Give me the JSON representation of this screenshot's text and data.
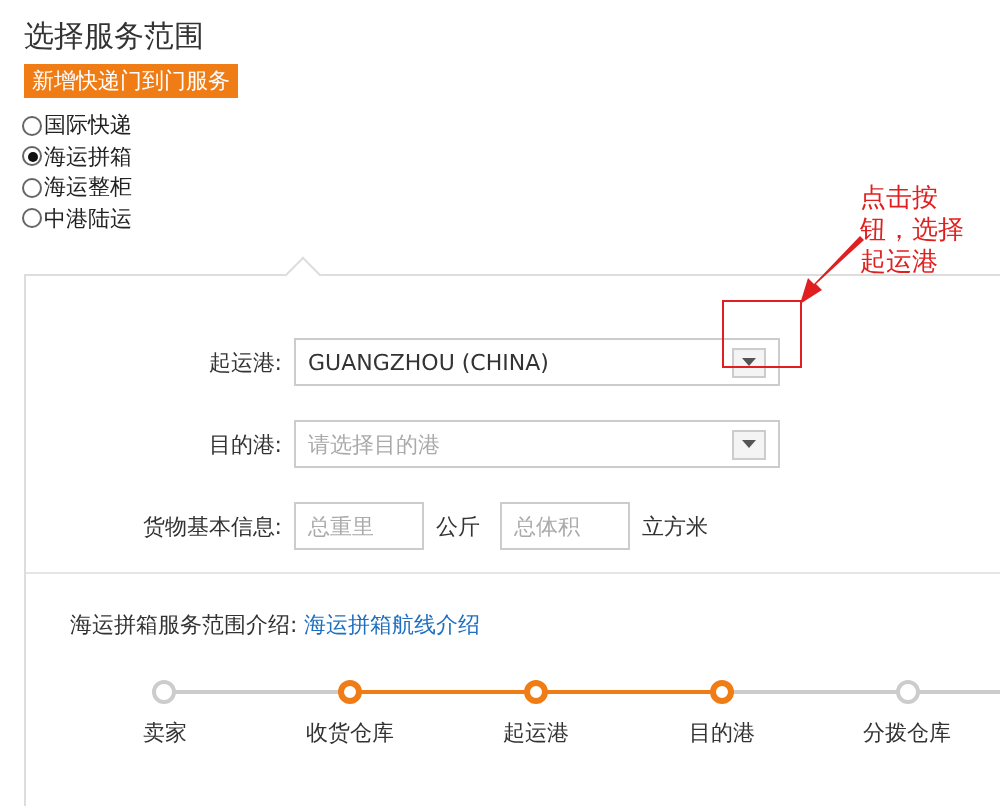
{
  "title": "选择服务范围",
  "badge": "新增快递门到门服务",
  "services": [
    {
      "label": "国际快递",
      "selected": false
    },
    {
      "label": "海运拼箱",
      "selected": true
    },
    {
      "label": "海运整柜",
      "selected": false
    },
    {
      "label": "中港陆运",
      "selected": false
    }
  ],
  "form": {
    "origin": {
      "label": "起运港:",
      "value": "GUANGZHOU (CHINA)"
    },
    "destination": {
      "label": "目的港:",
      "placeholder": "请选择目的港"
    },
    "cargo": {
      "label": "货物基本信息:",
      "weight_placeholder": "总重里",
      "weight_unit": "公斤",
      "volume_placeholder": "总体积",
      "volume_unit": "立方米"
    }
  },
  "intro": {
    "label": "海运拼箱服务范围介绍:",
    "link": "海运拼箱航线介绍"
  },
  "steps": [
    {
      "label": "卖家",
      "active": false
    },
    {
      "label": "收货仓库",
      "active": true
    },
    {
      "label": "起运港",
      "active": true
    },
    {
      "label": "目的港",
      "active": true
    },
    {
      "label": "分拨仓库",
      "active": false
    }
  ],
  "annotation": {
    "lines": [
      "点击按",
      "钮，选择",
      "起运港"
    ]
  }
}
